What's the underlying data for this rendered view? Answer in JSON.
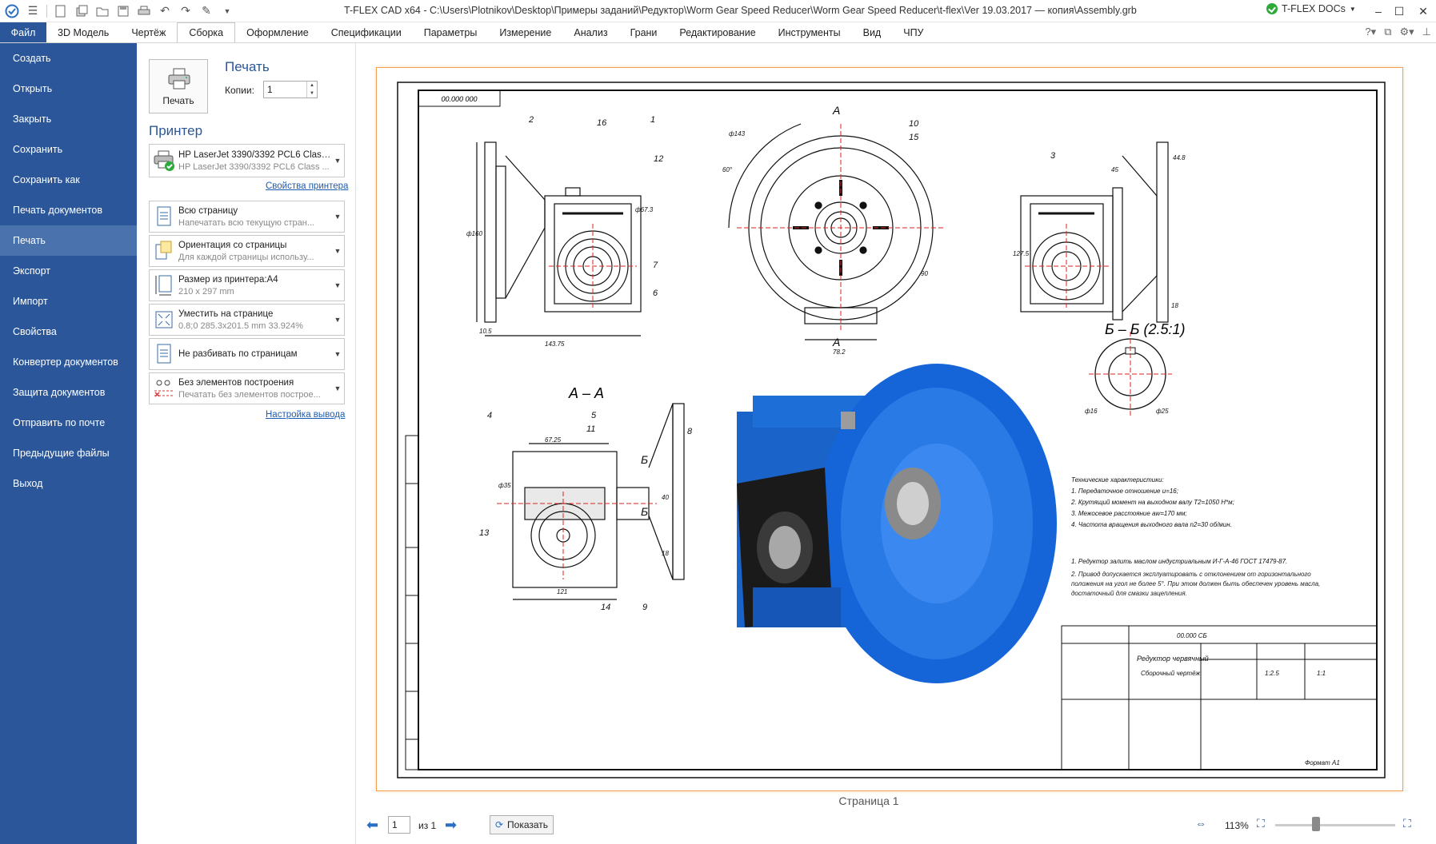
{
  "window": {
    "title": "T-FLEX CAD x64 - C:\\Users\\Plotnikov\\Desktop\\Примеры заданий\\Редуктор\\Worm Gear Speed Reducer\\Worm Gear Speed Reducer\\t-flex\\Ver 19.03.2017 — копия\\Assembly.grb",
    "docs_label": "T-FLEX DOCs"
  },
  "menu": {
    "file": "Файл",
    "items": [
      "3D Модель",
      "Чертёж",
      "Сборка",
      "Оформление",
      "Спецификации",
      "Параметры",
      "Измерение",
      "Анализ",
      "Грани",
      "Редактирование",
      "Инструменты",
      "Вид",
      "ЧПУ"
    ],
    "active_index": 2
  },
  "nav": {
    "items": [
      "Создать",
      "Открыть",
      "Закрыть",
      "Сохранить",
      "Сохранить как",
      "Печать документов",
      "Печать",
      "Экспорт",
      "Импорт",
      "Свойства",
      "Конвертер документов",
      "Защита документов",
      "Отправить по почте",
      "Предыдущие файлы",
      "Выход"
    ],
    "active_index": 6
  },
  "print": {
    "button_label": "Печать",
    "heading": "Печать",
    "copies_label": "Копии:",
    "copies_value": "1",
    "printer_heading": "Принтер",
    "printer_name": "HP LaserJet 3390/3392 PCL6 Class ...",
    "printer_sub": "HP LaserJet 3390/3392 PCL6 Class ...",
    "printer_props_link": "Свойства принтера",
    "options": [
      {
        "title": "Всю страницу",
        "sub": "Напечатать всю текущую стран..."
      },
      {
        "title": "Ориентация со страницы",
        "sub": "Для каждой страницы использу..."
      },
      {
        "title": "Размер из принтера:A4",
        "sub": "210 x 297 mm"
      },
      {
        "title": "Уместить на странице",
        "sub": "0.8;0  285.3x201.5 mm 33.924%"
      },
      {
        "title": "Не разбивать по страницам",
        "sub": ""
      },
      {
        "title": "Без элементов построения",
        "sub": "Печатать без элементов построе..."
      }
    ],
    "output_link": "Настройка вывода"
  },
  "preview": {
    "page_label": "Страница 1",
    "page_input": "1",
    "page_of": "из 1",
    "show_button": "Показать",
    "zoom": "113%",
    "zoom_fraction": 0.34
  },
  "drawing": {
    "stamp_top": "00.000 000",
    "section_aa_top": "А",
    "section_aa_bottom": "А",
    "section_aa_title": "А – А",
    "section_bb_title": "Б – Б (2.5:1)",
    "section_b_label": "Б",
    "callouts": [
      "2",
      "16",
      "1",
      "12",
      "7",
      "6",
      "10",
      "15",
      "3",
      "4",
      "5",
      "11",
      "8",
      "13",
      "14",
      "9"
    ],
    "dims": [
      "ф160",
      "10.5",
      "143.75",
      "ф67.3",
      "ф143",
      "60°",
      "90",
      "78.2",
      "44.8",
      "45",
      "127.5",
      "18",
      "67.25",
      "ф35",
      "40",
      "121",
      "ф16",
      "ф25",
      "18"
    ],
    "tech_notes": [
      "Технические характеристики:",
      "1. Передаточное отношение u=16;",
      "2. Крутящий момент на выходном валу T2=1050 Н*м;",
      "3. Межосевое расстояние aw=170 мм;",
      "4. Частота вращения выходного вала n2=30 об/мин.",
      "1.    Редуктор залить маслом индустриальным И-Г-А-46 ГОСТ 17479-87.",
      "2.    Привод допускается эксплуатировать с отклонением от горизонтального положения на угол не более 5°. При этом должен быть обеспечен уровень масла, достаточный для смазки зацепления."
    ],
    "title_block": {
      "code": "00.000 СБ",
      "name": "Редуктор червячный",
      "sub": "Сборочный чертёж",
      "mass": "1:2.5",
      "scale": "1:1",
      "format": "Формат А1"
    }
  }
}
